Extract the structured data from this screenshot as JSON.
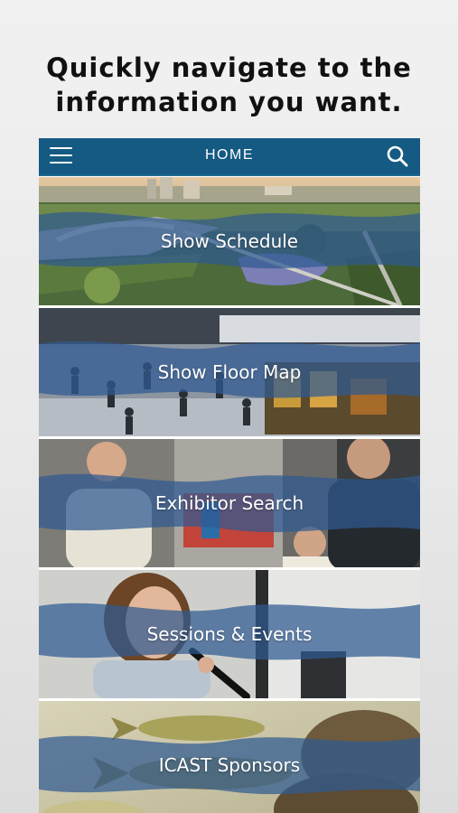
{
  "promo": {
    "line1": "Quickly navigate to the",
    "line2": "information you want."
  },
  "header": {
    "title": "HOME",
    "menu_icon": "hamburger-menu-icon",
    "search_icon": "search-icon",
    "background_color": "#145a82"
  },
  "tiles": [
    {
      "label": "Show Schedule"
    },
    {
      "label": "Show Floor Map"
    },
    {
      "label": "Exhibitor Search"
    },
    {
      "label": "Sessions & Events"
    },
    {
      "label": "ICAST Sponsors"
    }
  ],
  "colors": {
    "wave_overlay": "#2f5a92",
    "label_text": "#ffffff"
  }
}
